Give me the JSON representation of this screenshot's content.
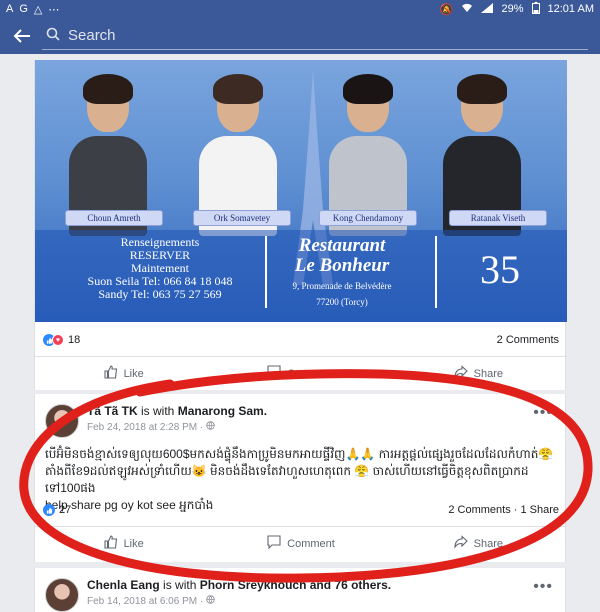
{
  "statusbar": {
    "left_icons": [
      "A",
      "G",
      "△",
      "⋯"
    ],
    "battery": "29%",
    "time": "12:01 AM"
  },
  "topbar": {
    "back_icon": "arrow-left",
    "search_icon": "search",
    "search_placeholder": "Search"
  },
  "post1": {
    "banner": {
      "people": [
        "Choun Amreth",
        "Ork Somavetey",
        "Kong Chendamony",
        "Ratanak Viseth"
      ],
      "info": [
        "Renseignements",
        "RESERVER",
        "Maintement",
        "Suon Seila Tel: 066 84 18 048",
        "Sandy Tel: 063 75 27 569"
      ],
      "restaurant_name_1": "Restaurant",
      "restaurant_name_2": "Le Bonheur",
      "address_1": "9, Promenade de Belvédère",
      "address_2": "77200 (Torcy)",
      "number": "35"
    },
    "reaction_count": "18",
    "comments_count": "2 Comments",
    "actions": {
      "like": "Like",
      "comment": "Comment",
      "share": "Share"
    }
  },
  "post2": {
    "author": "Tã Tã TK",
    "with_text": "is with",
    "tagged": "Manarong Sam.",
    "timestamp": "Feb 24, 2018 at 2:28 PM",
    "text_line1": "បើអ៊ំមិនចង់ខ្មាស់ទេឲ្យលុយ600$មកសង់ផ្ទុំនឹងកាប្រូមិនមកអាយផ្ទីវិញ🙏🙏 ការអត្តផ្ដល់ផ្សេងរួចដែលដែលកំហាត់😤",
    "text_line2": "តាំងពីខែ9ដល់ឥឡូវអស់ទ្រាំហើយ😺 មិនចង់ដឹងទេតែវាហួសហេតុពេក 😤 ចាស់ហើយនៅធ្វើចិត្តខុសពិតប្រាកដទៅ100ផង",
    "text_line3": "help share pg oy kot see អ្នកបាំង",
    "reaction_count": "27",
    "comments_shares": "2 Comments · 1 Share",
    "actions": {
      "like": "Like",
      "comment": "Comment",
      "share": "Share"
    }
  },
  "post3": {
    "author": "Chenla Eang",
    "with_text": "is with",
    "tagged": "Phorn Sreykhouch and 76 others.",
    "timestamp": "Feb 14, 2018 at 6:06 PM"
  },
  "colors": {
    "fb_blue": "#3b5998",
    "annotation_red": "#e0201b",
    "like_blue": "#2d88ff"
  }
}
